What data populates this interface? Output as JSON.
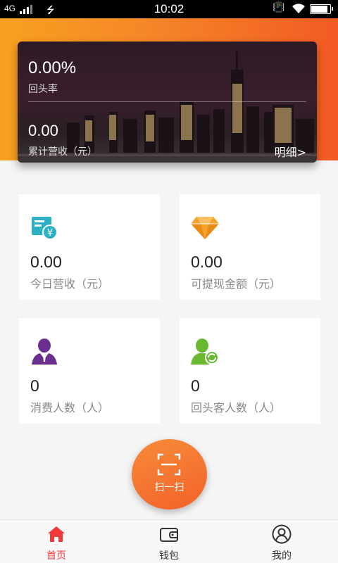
{
  "status_bar": {
    "network": "4G",
    "time": "10:02",
    "battery_level": 0.9
  },
  "summary": {
    "return_rate_value": "0.00%",
    "return_rate_label": "回头率",
    "total_revenue_value": "0.00",
    "total_revenue_label": "累计营收（元）",
    "detail_link": "明细>"
  },
  "stats": {
    "today_revenue": {
      "value": "0.00",
      "label": "今日营收（元）",
      "icon": "money-card-icon",
      "color": "#2bb0c5"
    },
    "withdrawable": {
      "value": "0.00",
      "label": "可提现金额（元）",
      "icon": "diamond-icon",
      "color": "#f5a12a"
    },
    "consumers": {
      "value": "0",
      "label": "消费人数（人）",
      "icon": "person-icon",
      "color": "#6b2f8f"
    },
    "returning_customers": {
      "value": "0",
      "label": "回头客人数（人）",
      "icon": "returning-person-icon",
      "color": "#69b832"
    }
  },
  "scan": {
    "label": "扫一扫",
    "icon": "scan-icon"
  },
  "nav": {
    "items": [
      {
        "label": "首页",
        "icon": "home-icon",
        "active": true
      },
      {
        "label": "钱包",
        "icon": "wallet-icon",
        "active": false
      },
      {
        "label": "我的",
        "icon": "user-circle-icon",
        "active": false
      }
    ]
  },
  "colors": {
    "header_gradient_start": "#f7a11f",
    "header_gradient_end": "#f25a24",
    "active_nav": "#f03a3a",
    "scan_button": "#f2622a"
  }
}
